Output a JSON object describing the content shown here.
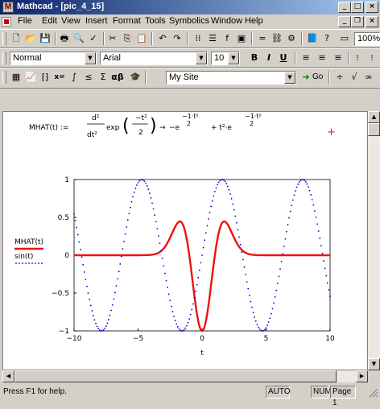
{
  "window": {
    "title": "Mathcad - [pic_4_15]"
  },
  "menu": [
    "File",
    "Edit",
    "View",
    "Insert",
    "Format",
    "Tools",
    "Symbolics",
    "Window",
    "Help"
  ],
  "format_toolbar": {
    "style": "Normal",
    "font": "Arial",
    "size": "10",
    "bold": "B",
    "italic": "I",
    "underline": "U"
  },
  "math_toolbar": {
    "resource": "My Site",
    "go": "Go"
  },
  "equation": {
    "lhs": "MHAT(t) :=",
    "numerator": "d²",
    "denominator": "dt²",
    "exp": "exp",
    "exp_arg_num": "−t²",
    "exp_arg_den": "2",
    "arrow": "→",
    "rhs1": "−e",
    "rhs1_exp": "−1·t²",
    "rhs1_exp_den": "2",
    "plus": "+ t²·e",
    "rhs2_exp": "−1·t²",
    "rhs2_exp_den": "2"
  },
  "chart_data": {
    "type": "line",
    "xlabel": "t",
    "xlim": [
      -10,
      10
    ],
    "ylim": [
      -1,
      1
    ],
    "x_ticks": [
      "−10",
      "−5",
      "0",
      "5",
      "10"
    ],
    "y_ticks": [
      "1",
      "0.5",
      "0",
      "−0.5",
      "−1"
    ],
    "series": [
      {
        "name": "MHAT(t)",
        "style": "solid",
        "color": "#ee1111",
        "function": "(t^2-1)*exp(-t^2/2)"
      },
      {
        "name": "sin(t)",
        "style": "dotted",
        "color": "#0000cc",
        "function": "sin(t)"
      }
    ]
  },
  "status": {
    "hint": "Press F1 for help.",
    "mode": "AUTO",
    "num": "NUM",
    "page": "Page 1"
  },
  "colors": {
    "titlebar_start": "#0a246a",
    "titlebar_end": "#a6caf0",
    "mhat": "#ee1111",
    "sin": "#0000cc"
  }
}
